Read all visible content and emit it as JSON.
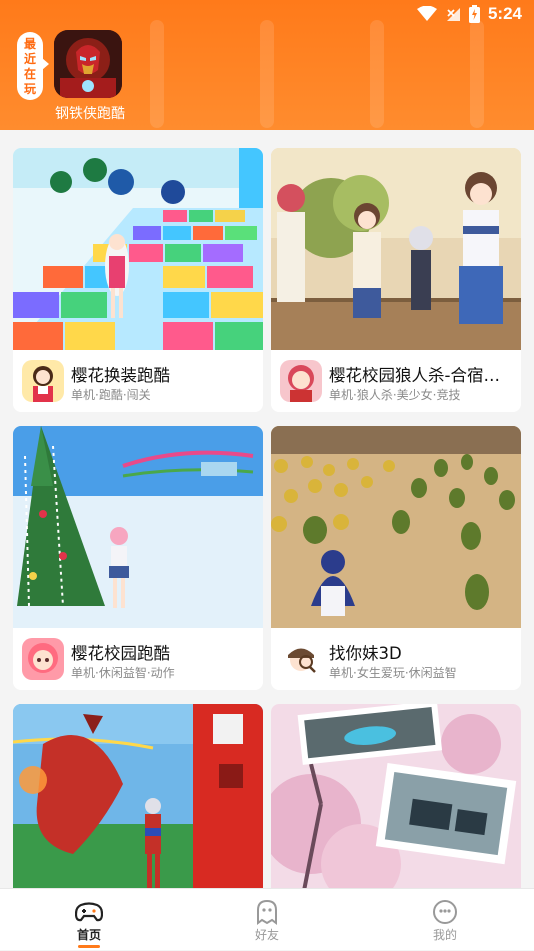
{
  "status_bar": {
    "time": "5:24",
    "icons": [
      "wifi-icon",
      "no-signal-icon",
      "battery-charging-icon"
    ]
  },
  "recent": {
    "tag": [
      "最",
      "近",
      "在",
      "玩"
    ],
    "game_name": "钢铁侠跑酷"
  },
  "games": [
    {
      "title": "樱花换装跑酷",
      "tags": "单机·跑酷·闯关"
    },
    {
      "title": "樱花校园狼人杀-合宿…",
      "tags": "单机·狼人杀·美少女·竞技"
    },
    {
      "title": "樱花校园跑酷",
      "tags": "单机·休闲益智·动作"
    },
    {
      "title": "找你妹3D",
      "tags": "单机·女生爱玩·休闲益智"
    },
    {
      "title": "",
      "tags": ""
    },
    {
      "title": "",
      "tags": ""
    }
  ],
  "tabs": [
    {
      "label": "首页",
      "icon": "gamepad-icon",
      "active": true
    },
    {
      "label": "好友",
      "icon": "ghost-icon",
      "active": false
    },
    {
      "label": "我的",
      "icon": "smiley-icon",
      "active": false
    }
  ],
  "colors": {
    "accent": "#ff7a1a",
    "header": "#ff8c2e"
  }
}
